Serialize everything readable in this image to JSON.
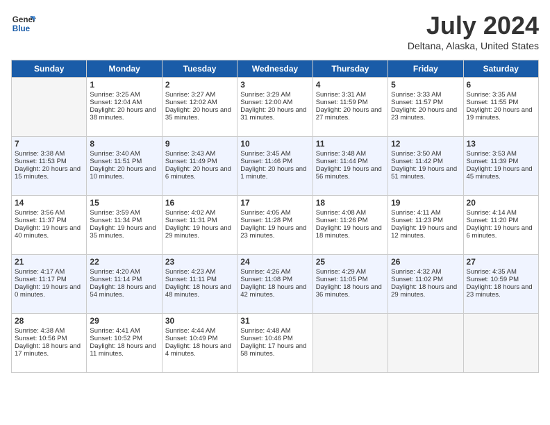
{
  "header": {
    "logo_line1": "General",
    "logo_line2": "Blue",
    "title": "July 2024",
    "subtitle": "Deltana, Alaska, United States"
  },
  "days_of_week": [
    "Sunday",
    "Monday",
    "Tuesday",
    "Wednesday",
    "Thursday",
    "Friday",
    "Saturday"
  ],
  "weeks": [
    [
      {
        "day": null
      },
      {
        "day": 1,
        "sunrise": "Sunrise: 3:25 AM",
        "sunset": "Sunset: 12:04 AM",
        "daylight": "Daylight: 20 hours and 38 minutes."
      },
      {
        "day": 2,
        "sunrise": "Sunrise: 3:27 AM",
        "sunset": "Sunset: 12:02 AM",
        "daylight": "Daylight: 20 hours and 35 minutes."
      },
      {
        "day": 3,
        "sunrise": "Sunrise: 3:29 AM",
        "sunset": "Sunset: 12:00 AM",
        "daylight": "Daylight: 20 hours and 31 minutes."
      },
      {
        "day": 4,
        "sunrise": "Sunrise: 3:31 AM",
        "sunset": "Sunset: 11:59 PM",
        "daylight": "Daylight: 20 hours and 27 minutes."
      },
      {
        "day": 5,
        "sunrise": "Sunrise: 3:33 AM",
        "sunset": "Sunset: 11:57 PM",
        "daylight": "Daylight: 20 hours and 23 minutes."
      },
      {
        "day": 6,
        "sunrise": "Sunrise: 3:35 AM",
        "sunset": "Sunset: 11:55 PM",
        "daylight": "Daylight: 20 hours and 19 minutes."
      }
    ],
    [
      {
        "day": 7,
        "sunrise": "Sunrise: 3:38 AM",
        "sunset": "Sunset: 11:53 PM",
        "daylight": "Daylight: 20 hours and 15 minutes."
      },
      {
        "day": 8,
        "sunrise": "Sunrise: 3:40 AM",
        "sunset": "Sunset: 11:51 PM",
        "daylight": "Daylight: 20 hours and 10 minutes."
      },
      {
        "day": 9,
        "sunrise": "Sunrise: 3:43 AM",
        "sunset": "Sunset: 11:49 PM",
        "daylight": "Daylight: 20 hours and 6 minutes."
      },
      {
        "day": 10,
        "sunrise": "Sunrise: 3:45 AM",
        "sunset": "Sunset: 11:46 PM",
        "daylight": "Daylight: 20 hours and 1 minute."
      },
      {
        "day": 11,
        "sunrise": "Sunrise: 3:48 AM",
        "sunset": "Sunset: 11:44 PM",
        "daylight": "Daylight: 19 hours and 56 minutes."
      },
      {
        "day": 12,
        "sunrise": "Sunrise: 3:50 AM",
        "sunset": "Sunset: 11:42 PM",
        "daylight": "Daylight: 19 hours and 51 minutes."
      },
      {
        "day": 13,
        "sunrise": "Sunrise: 3:53 AM",
        "sunset": "Sunset: 11:39 PM",
        "daylight": "Daylight: 19 hours and 45 minutes."
      }
    ],
    [
      {
        "day": 14,
        "sunrise": "Sunrise: 3:56 AM",
        "sunset": "Sunset: 11:37 PM",
        "daylight": "Daylight: 19 hours and 40 minutes."
      },
      {
        "day": 15,
        "sunrise": "Sunrise: 3:59 AM",
        "sunset": "Sunset: 11:34 PM",
        "daylight": "Daylight: 19 hours and 35 minutes."
      },
      {
        "day": 16,
        "sunrise": "Sunrise: 4:02 AM",
        "sunset": "Sunset: 11:31 PM",
        "daylight": "Daylight: 19 hours and 29 minutes."
      },
      {
        "day": 17,
        "sunrise": "Sunrise: 4:05 AM",
        "sunset": "Sunset: 11:28 PM",
        "daylight": "Daylight: 19 hours and 23 minutes."
      },
      {
        "day": 18,
        "sunrise": "Sunrise: 4:08 AM",
        "sunset": "Sunset: 11:26 PM",
        "daylight": "Daylight: 19 hours and 18 minutes."
      },
      {
        "day": 19,
        "sunrise": "Sunrise: 4:11 AM",
        "sunset": "Sunset: 11:23 PM",
        "daylight": "Daylight: 19 hours and 12 minutes."
      },
      {
        "day": 20,
        "sunrise": "Sunrise: 4:14 AM",
        "sunset": "Sunset: 11:20 PM",
        "daylight": "Daylight: 19 hours and 6 minutes."
      }
    ],
    [
      {
        "day": 21,
        "sunrise": "Sunrise: 4:17 AM",
        "sunset": "Sunset: 11:17 PM",
        "daylight": "Daylight: 19 hours and 0 minutes."
      },
      {
        "day": 22,
        "sunrise": "Sunrise: 4:20 AM",
        "sunset": "Sunset: 11:14 PM",
        "daylight": "Daylight: 18 hours and 54 minutes."
      },
      {
        "day": 23,
        "sunrise": "Sunrise: 4:23 AM",
        "sunset": "Sunset: 11:11 PM",
        "daylight": "Daylight: 18 hours and 48 minutes."
      },
      {
        "day": 24,
        "sunrise": "Sunrise: 4:26 AM",
        "sunset": "Sunset: 11:08 PM",
        "daylight": "Daylight: 18 hours and 42 minutes."
      },
      {
        "day": 25,
        "sunrise": "Sunrise: 4:29 AM",
        "sunset": "Sunset: 11:05 PM",
        "daylight": "Daylight: 18 hours and 36 minutes."
      },
      {
        "day": 26,
        "sunrise": "Sunrise: 4:32 AM",
        "sunset": "Sunset: 11:02 PM",
        "daylight": "Daylight: 18 hours and 29 minutes."
      },
      {
        "day": 27,
        "sunrise": "Sunrise: 4:35 AM",
        "sunset": "Sunset: 10:59 PM",
        "daylight": "Daylight: 18 hours and 23 minutes."
      }
    ],
    [
      {
        "day": 28,
        "sunrise": "Sunrise: 4:38 AM",
        "sunset": "Sunset: 10:56 PM",
        "daylight": "Daylight: 18 hours and 17 minutes."
      },
      {
        "day": 29,
        "sunrise": "Sunrise: 4:41 AM",
        "sunset": "Sunset: 10:52 PM",
        "daylight": "Daylight: 18 hours and 11 minutes."
      },
      {
        "day": 30,
        "sunrise": "Sunrise: 4:44 AM",
        "sunset": "Sunset: 10:49 PM",
        "daylight": "Daylight: 18 hours and 4 minutes."
      },
      {
        "day": 31,
        "sunrise": "Sunrise: 4:48 AM",
        "sunset": "Sunset: 10:46 PM",
        "daylight": "Daylight: 17 hours and 58 minutes."
      },
      {
        "day": null
      },
      {
        "day": null
      },
      {
        "day": null
      }
    ]
  ]
}
